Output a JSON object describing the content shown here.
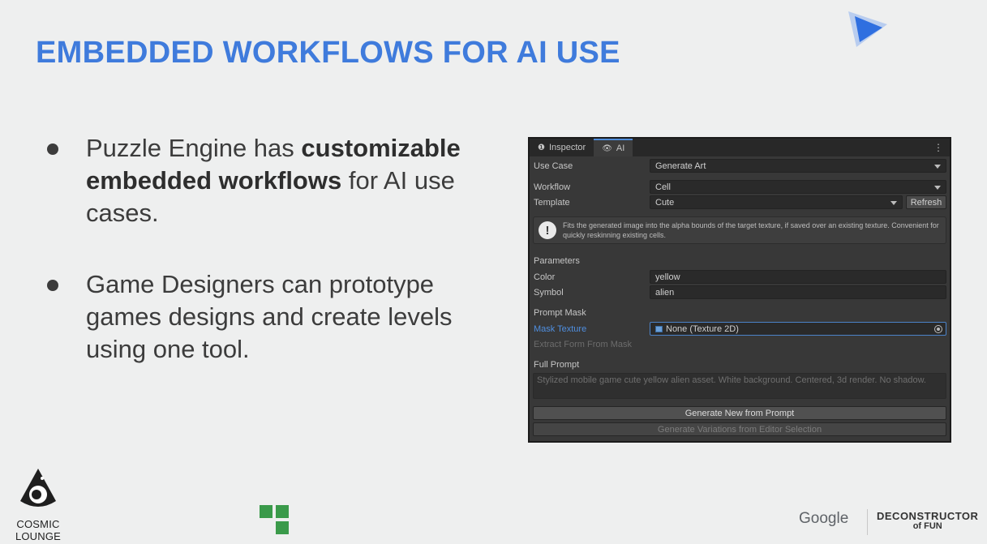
{
  "slide": {
    "title": "EMBEDDED WORKFLOWS FOR AI USE",
    "bullets": [
      {
        "pre": "Puzzle Engine has ",
        "bold": "customizable embedded workflows",
        "post": " for AI use cases."
      },
      {
        "text": "Game Designers can prototype games designs and create levels using one tool."
      }
    ]
  },
  "panel": {
    "tabs": [
      {
        "label": "Inspector",
        "icon": "info-icon"
      },
      {
        "label": "AI",
        "icon": "eye-icon"
      }
    ],
    "use_case": {
      "label": "Use Case",
      "value": "Generate Art"
    },
    "workflow": {
      "label": "Workflow",
      "value": "Cell"
    },
    "template": {
      "label": "Template",
      "value": "Cute",
      "refresh": "Refresh"
    },
    "help": "Fits the generated image into the alpha bounds of the target texture, if saved over an existing texture. Convenient for quickly reskinning existing cells.",
    "parameters": {
      "header": "Parameters",
      "color": {
        "label": "Color",
        "value": "yellow"
      },
      "symbol": {
        "label": "Symbol",
        "value": "alien"
      }
    },
    "prompt_mask": {
      "header": "Prompt Mask",
      "mask_texture": {
        "label": "Mask Texture",
        "value": "None (Texture 2D)"
      },
      "extract": "Extract Form From Mask"
    },
    "full_prompt": {
      "header": "Full Prompt",
      "text": "Stylized mobile game cute yellow alien asset. White background. Centered, 3d render. No shadow."
    },
    "buttons": {
      "generate_new": "Generate New from Prompt",
      "generate_variations": "Generate Variations from Editor Selection"
    }
  },
  "footer": {
    "cosmic_lounge": [
      "COSMIC",
      "LOUNGE"
    ],
    "google": "Google",
    "deconstructor": {
      "line1": "DECONSTRUCTOR",
      "line2": "of FUN"
    }
  },
  "colors": {
    "title": "#3f7bdc",
    "panel_bg": "#383838",
    "link": "#4f8fe0"
  }
}
